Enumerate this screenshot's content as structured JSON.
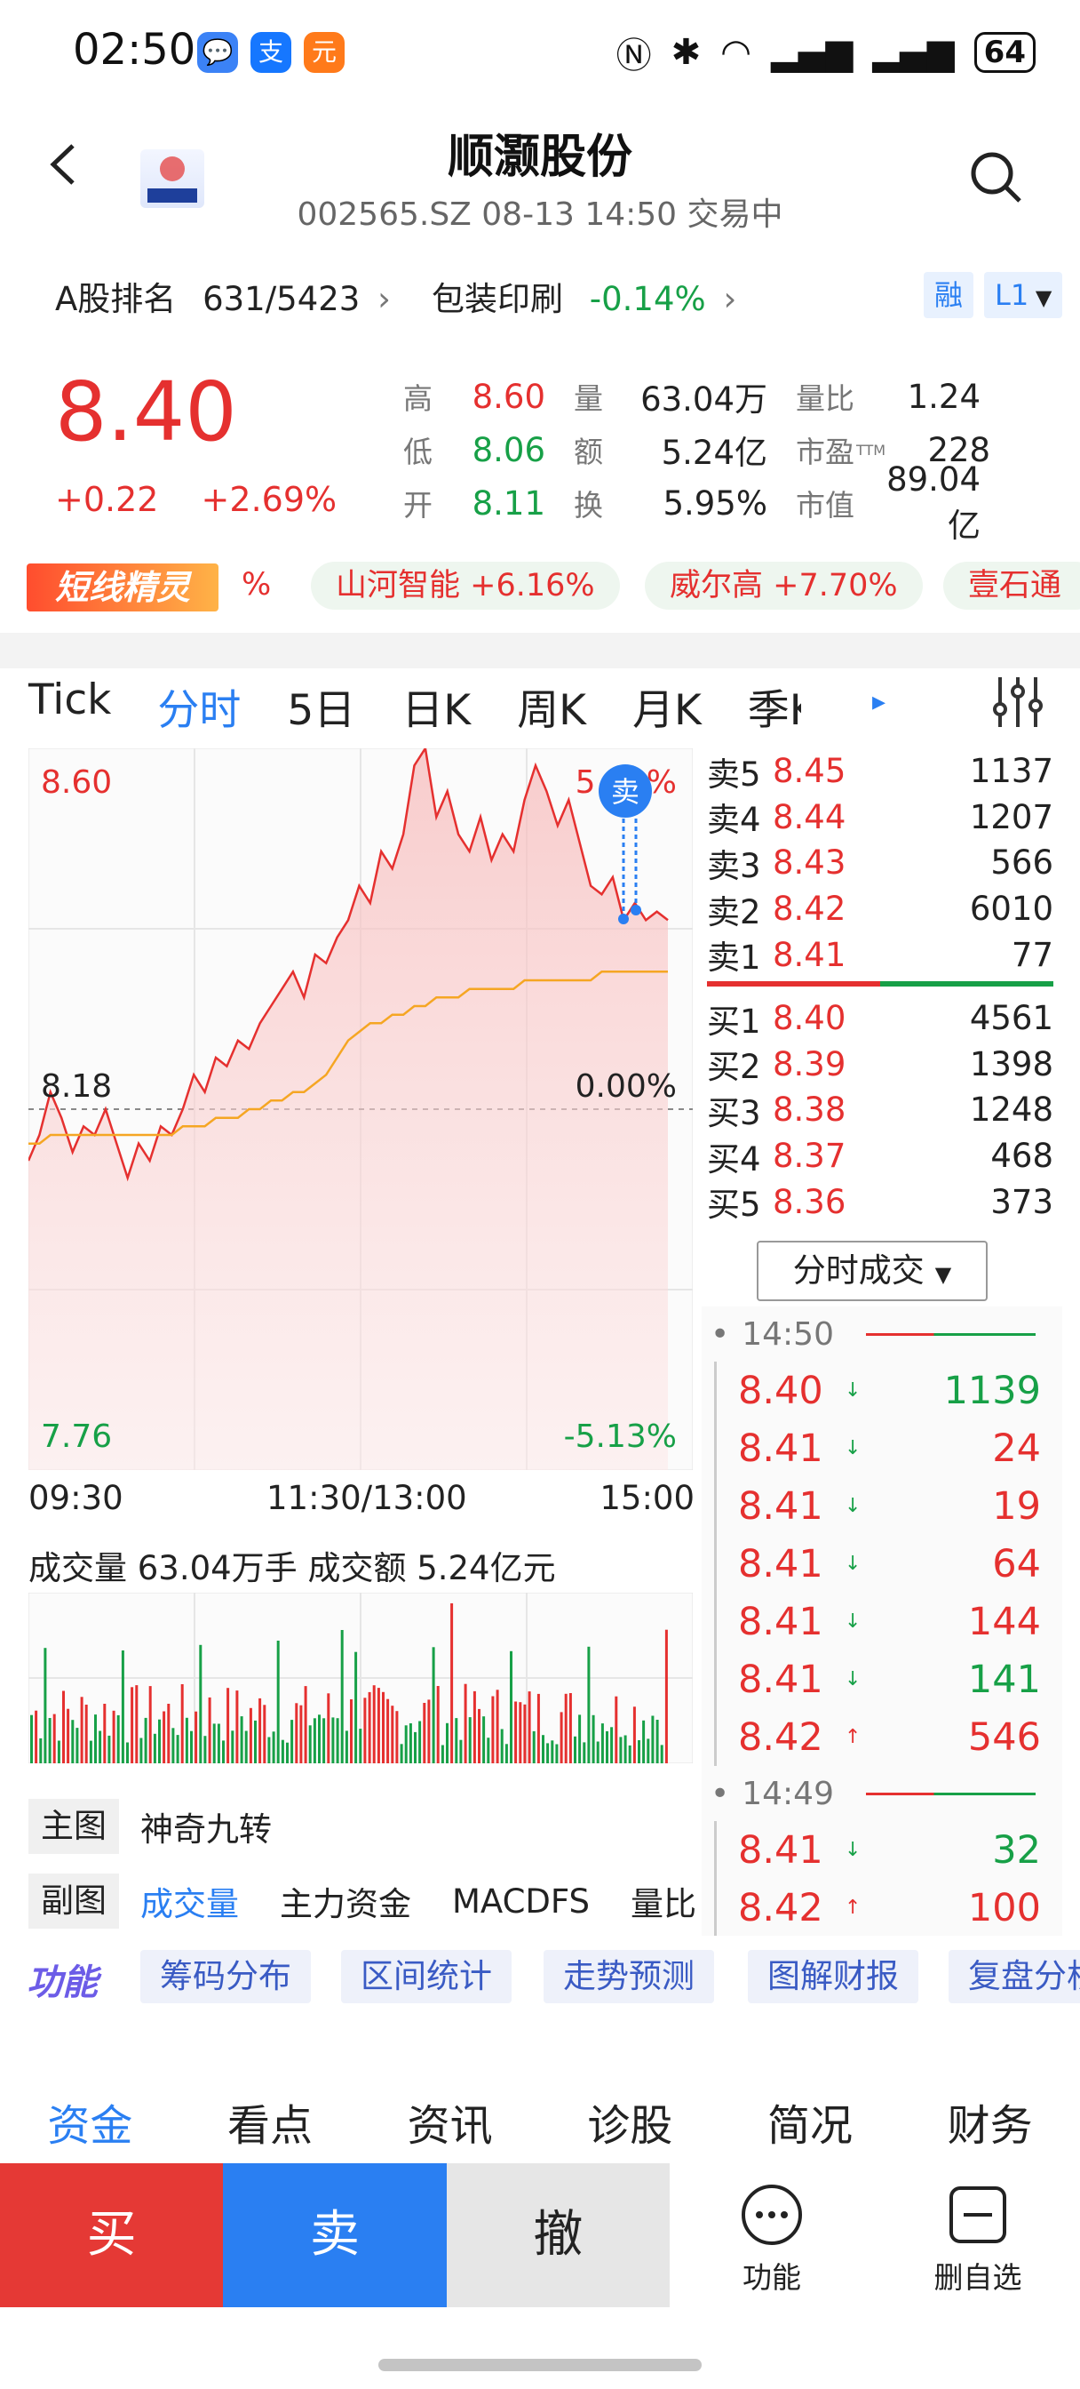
{
  "status_bar": {
    "time": "02:50",
    "battery": "64",
    "apps": [
      "💬",
      "支",
      "元"
    ]
  },
  "header": {
    "title": "顺灏股份",
    "subtitle": "002565.SZ  08-13 14:50  交易中"
  },
  "rank": {
    "label": "A股排名",
    "value": "631/5423",
    "sector": "包装印刷",
    "sector_change": "-0.14%",
    "tag_margin": "融",
    "tag_level": "L1"
  },
  "quote": {
    "price": "8.40",
    "change": "+0.22",
    "change_pct": "+2.69%",
    "rows": [
      [
        {
          "label": "高",
          "value": "8.60",
          "color": "red"
        },
        {
          "label": "量",
          "value": "63.04万",
          "color": "dark"
        },
        {
          "label": "量比",
          "value": "1.24",
          "color": "dark"
        }
      ],
      [
        {
          "label": "低",
          "value": "8.06",
          "color": "green"
        },
        {
          "label": "额",
          "value": "5.24亿",
          "color": "dark"
        },
        {
          "label": "市盈",
          "sup": "TTM",
          "value": "228",
          "color": "dark"
        }
      ],
      [
        {
          "label": "开",
          "value": "8.11",
          "color": "green"
        },
        {
          "label": "换",
          "value": "5.95%",
          "color": "dark"
        },
        {
          "label": "市值",
          "value": "89.04亿",
          "color": "dark"
        }
      ]
    ]
  },
  "marquee": {
    "brand": "短线精灵",
    "partial_left": "%",
    "items": [
      {
        "text": "山河智能 +6.16%"
      },
      {
        "text": "威尔高 +7.70%"
      },
      {
        "text": "壹石通"
      }
    ]
  },
  "chart_tabs": [
    "Tick",
    "分时",
    "5日",
    "日K",
    "周K",
    "月K",
    "季K"
  ],
  "chart_tabs_active": 1,
  "chart_labels": {
    "high": "8.60",
    "high_pct": "5.13%",
    "mid": "8.18",
    "mid_pct": "0.00%",
    "low": "7.76",
    "low_pct": "-5.13%",
    "sell_marker": "卖",
    "x_start": "09:30",
    "x_mid": "11:30/13:00",
    "x_end": "15:00"
  },
  "chart_data": {
    "type": "line",
    "title": "",
    "ylim": [
      7.76,
      8.6
    ],
    "prev_close": 8.18,
    "xlabels": [
      "09:30",
      "11:30/13:00",
      "15:00"
    ],
    "series": [
      {
        "values": [
          8.12,
          8.15,
          8.2,
          8.17,
          8.13,
          8.16,
          8.15,
          8.18,
          8.14,
          8.1,
          8.14,
          8.12,
          8.16,
          8.15,
          8.18,
          8.22,
          8.2,
          8.24,
          8.23,
          8.26,
          8.25,
          8.28,
          8.3,
          8.32,
          8.34,
          8.31,
          8.36,
          8.35,
          8.38,
          8.4,
          8.44,
          8.42,
          8.48,
          8.46,
          8.5,
          8.58,
          8.6,
          8.52,
          8.55,
          8.5,
          8.48,
          8.52,
          8.47,
          8.5,
          8.48,
          8.54,
          8.58,
          8.55,
          8.51,
          8.54,
          8.49,
          8.44,
          8.43,
          8.45,
          8.4,
          8.42,
          8.4,
          8.41,
          8.4
        ]
      },
      {
        "values": [
          8.14,
          8.14,
          8.15,
          8.15,
          8.15,
          8.15,
          8.15,
          8.15,
          8.15,
          8.15,
          8.15,
          8.15,
          8.15,
          8.15,
          8.16,
          8.16,
          8.16,
          8.17,
          8.17,
          8.17,
          8.18,
          8.18,
          8.19,
          8.19,
          8.2,
          8.2,
          8.21,
          8.22,
          8.24,
          8.26,
          8.27,
          8.28,
          8.28,
          8.29,
          8.29,
          8.3,
          8.3,
          8.31,
          8.31,
          8.31,
          8.32,
          8.32,
          8.32,
          8.32,
          8.32,
          8.33,
          8.33,
          8.33,
          8.33,
          8.33,
          8.33,
          8.33,
          8.34,
          8.34,
          8.34,
          8.34,
          8.34,
          8.34,
          8.34
        ]
      }
    ]
  },
  "order_book": {
    "sell": [
      {
        "label": "卖5",
        "price": "8.45",
        "vol": "1137"
      },
      {
        "label": "卖4",
        "price": "8.44",
        "vol": "1207"
      },
      {
        "label": "卖3",
        "price": "8.43",
        "vol": "566"
      },
      {
        "label": "卖2",
        "price": "8.42",
        "vol": "6010"
      },
      {
        "label": "卖1",
        "price": "8.41",
        "vol": "77"
      }
    ],
    "buy": [
      {
        "label": "买1",
        "price": "8.40",
        "vol": "4561"
      },
      {
        "label": "买2",
        "price": "8.39",
        "vol": "1398"
      },
      {
        "label": "买3",
        "price": "8.38",
        "vol": "1248"
      },
      {
        "label": "买4",
        "price": "8.37",
        "vol": "468"
      },
      {
        "label": "买5",
        "price": "8.36",
        "vol": "373"
      }
    ],
    "dropdown": "分时成交"
  },
  "ticks": {
    "groups": [
      {
        "time": "14:50",
        "rows": [
          {
            "price": "8.40",
            "dir": "down",
            "vol": "1139",
            "vcolor": "green"
          },
          {
            "price": "8.41",
            "dir": "down",
            "vol": "24",
            "vcolor": "red"
          },
          {
            "price": "8.41",
            "dir": "down",
            "vol": "19",
            "vcolor": "red"
          },
          {
            "price": "8.41",
            "dir": "down",
            "vol": "64",
            "vcolor": "red"
          },
          {
            "price": "8.41",
            "dir": "down",
            "vol": "144",
            "vcolor": "red"
          },
          {
            "price": "8.41",
            "dir": "down",
            "vol": "141",
            "vcolor": "green"
          },
          {
            "price": "8.42",
            "dir": "up",
            "vol": "546",
            "vcolor": "red"
          }
        ]
      },
      {
        "time": "14:49",
        "rows": [
          {
            "price": "8.41",
            "dir": "down",
            "vol": "32",
            "vcolor": "green"
          },
          {
            "price": "8.42",
            "dir": "up",
            "vol": "100",
            "vcolor": "red"
          }
        ]
      }
    ]
  },
  "volume": {
    "label": "成交量 63.04万手  成交额 5.24亿元"
  },
  "main_chart": {
    "label": "主图",
    "value": "神奇九转"
  },
  "sub_chart": {
    "label": "副图",
    "items": [
      "成交量",
      "主力资金",
      "MACDFS",
      "量比"
    ]
  },
  "functions": {
    "badge": "功能",
    "items": [
      "筹码分布",
      "区间统计",
      "走势预测",
      "图解财报",
      "复盘分析"
    ]
  },
  "bottom_tabs": [
    "资金",
    "看点",
    "资讯",
    "诊股",
    "简况",
    "财务"
  ],
  "trade_bar": {
    "buy": "买",
    "sell": "卖",
    "cancel": "撤",
    "func": "功能",
    "remove": "删自选"
  },
  "colors": {
    "up": "#e5302f",
    "down": "#17a047",
    "accent": "#2a7ff2",
    "avg_line": "#f5a623"
  }
}
